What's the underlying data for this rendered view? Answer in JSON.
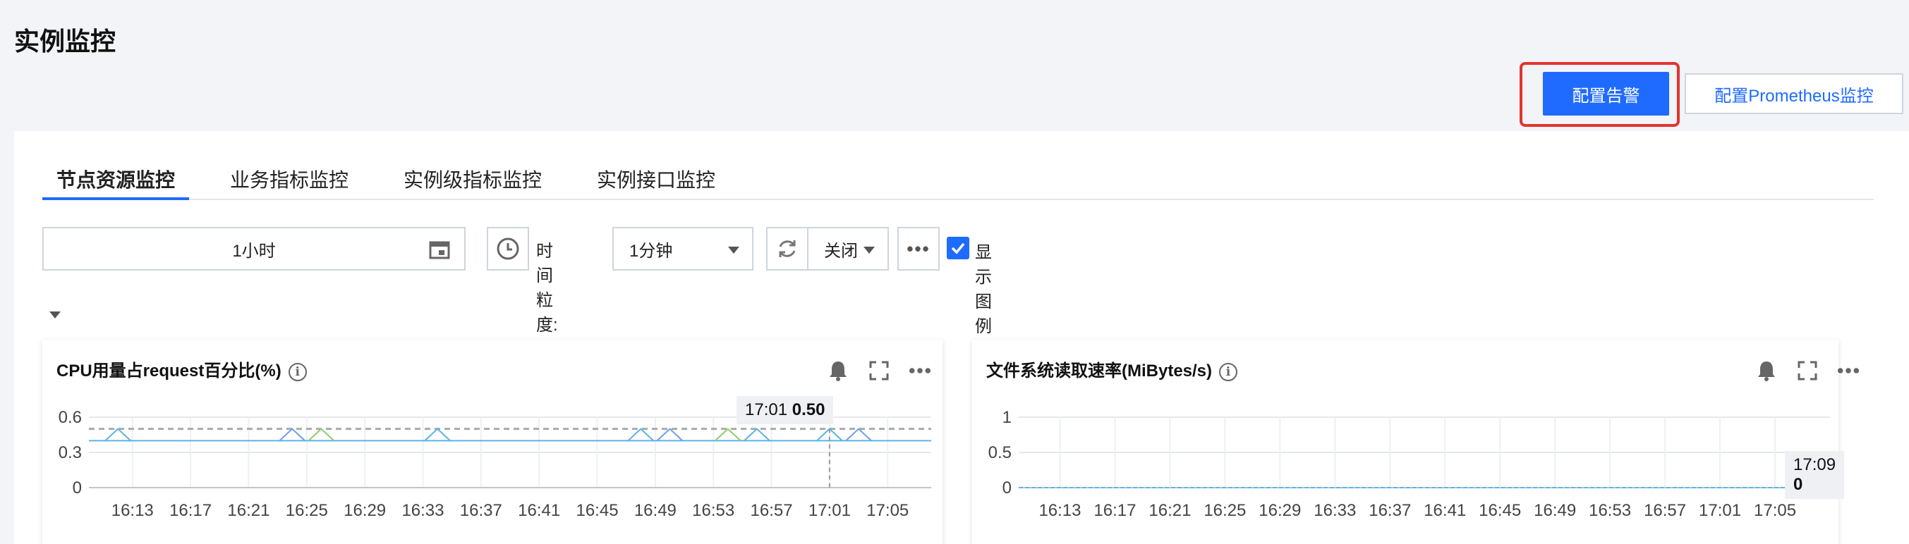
{
  "page": {
    "title": "实例监控"
  },
  "header_actions": {
    "configure_alert": "配置告警",
    "configure_prometheus": "配置Prometheus监控"
  },
  "tabs": [
    {
      "label": "节点资源监控",
      "active": true
    },
    {
      "label": "业务指标监控",
      "active": false
    },
    {
      "label": "实例级指标监控",
      "active": false
    },
    {
      "label": "实例接口监控",
      "active": false
    }
  ],
  "toolbar": {
    "time_range": "1小时",
    "granularity_label": "时间粒度:",
    "granularity_value": "1分钟",
    "auto_refresh_value": "关闭",
    "more_label": "•••",
    "show_legend_label": "显示图例",
    "show_legend_checked": true
  },
  "panels": [
    {
      "title": "CPU用量占request百分比(%)",
      "tooltip_time": "17:01",
      "tooltip_value": "0.50"
    },
    {
      "title": "文件系统读取速率(MiBytes/s)",
      "tooltip_time": "17:09",
      "tooltip_value": "0"
    }
  ],
  "colors": {
    "accent": "#1f6bff",
    "highlight": "#e5322d"
  },
  "chart_data": [
    {
      "type": "line",
      "title": "CPU用量占request百分比(%)",
      "x": [
        "16:13",
        "16:17",
        "16:21",
        "16:25",
        "16:29",
        "16:33",
        "16:37",
        "16:41",
        "16:45",
        "16:49",
        "16:53",
        "16:57",
        "17:01",
        "17:05"
      ],
      "y_ticks": [
        "0.6",
        "0.3",
        "0"
      ],
      "ylim": [
        0,
        0.6
      ],
      "grid": true,
      "reference_line": 0.5,
      "series": [
        {
          "color": "#5bb3e6",
          "baseline": 0.4,
          "spike": 0.5,
          "spike_at": [
            "16:12",
            "16:24",
            "16:26",
            "16:34",
            "16:48",
            "16:50",
            "16:54",
            "16:56",
            "17:01",
            "17:03"
          ]
        }
      ]
    },
    {
      "type": "line",
      "title": "文件系统读取速率(MiBytes/s)",
      "x": [
        "16:13",
        "16:17",
        "16:21",
        "16:25",
        "16:29",
        "16:33",
        "16:37",
        "16:41",
        "16:45",
        "16:49",
        "16:53",
        "16:57",
        "17:01",
        "17:05"
      ],
      "y_ticks": [
        "1",
        "0.5",
        "0"
      ],
      "ylim": [
        0,
        1
      ],
      "grid": true,
      "series": [
        {
          "color": "#5bb3e6",
          "values": [
            0,
            0,
            0,
            0,
            0,
            0,
            0,
            0,
            0,
            0,
            0,
            0,
            0,
            0
          ]
        }
      ]
    }
  ]
}
